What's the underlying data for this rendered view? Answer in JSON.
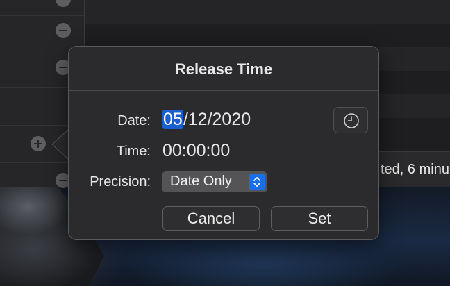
{
  "background": {
    "status_text": "ted, 6 minu"
  },
  "popover": {
    "title": "Release Time",
    "date_label": "Date:",
    "date_selected_segment": "05",
    "date_rest": "/12/2020",
    "time_label": "Time:",
    "time_value": "00:00:00",
    "precision_label": "Precision:",
    "precision_value": "Date Only",
    "cancel_label": "Cancel",
    "set_label": "Set"
  },
  "icons": {
    "clock": "clock-icon",
    "chevrons": "up-down-chevron-icon",
    "remove": "minus-circle-icon",
    "add": "plus-circle-icon"
  },
  "colors": {
    "accent": "#1a6ee8",
    "selection": "#1a5fd0"
  }
}
